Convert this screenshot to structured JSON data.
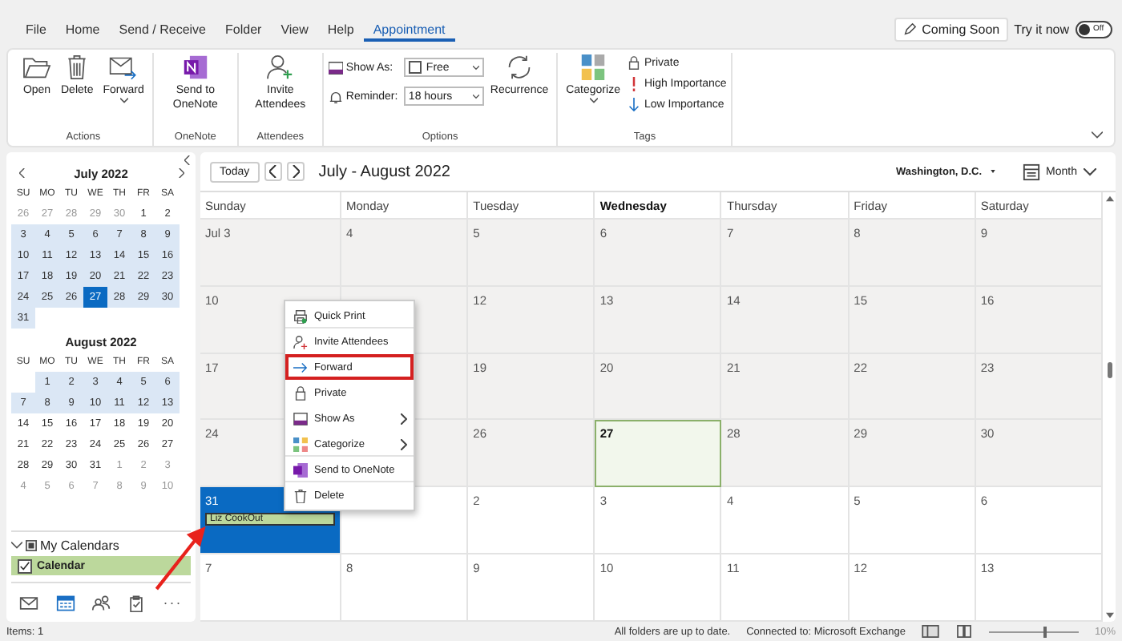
{
  "menu_tabs": [
    {
      "label": "File",
      "selected": false
    },
    {
      "label": "Home",
      "selected": false
    },
    {
      "label": "Send / Receive",
      "selected": false
    },
    {
      "label": "Folder",
      "selected": false
    },
    {
      "label": "View",
      "selected": false
    },
    {
      "label": "Help",
      "selected": false
    },
    {
      "label": "Appointment",
      "selected": true
    }
  ],
  "coming_soon": {
    "label": "Coming Soon",
    "try_label": "Try it now",
    "toggle_label": "Off",
    "on": false
  },
  "ribbon": {
    "groups": [
      {
        "label": "Actions",
        "kind": "buttons",
        "buttons": [
          {
            "label": "Open",
            "kind": "folder",
            "dropdown": false
          },
          {
            "label": "Delete",
            "kind": "trash",
            "dropdown": false
          },
          {
            "label": "Forward",
            "kind": "forward",
            "dropdown": true
          }
        ]
      },
      {
        "label": "OneNote",
        "kind": "buttons",
        "buttons": [
          {
            "label": "Send to OneNote",
            "kind": "onenote",
            "dropdown": false
          }
        ]
      },
      {
        "label": "Attendees",
        "kind": "buttons",
        "buttons": [
          {
            "label": "Invite Attendees",
            "kind": "person-add",
            "dropdown": false
          }
        ]
      },
      {
        "label": "Options",
        "kind": "options",
        "show_as": {
          "label": "Show As:",
          "value": "Free"
        },
        "reminder": {
          "label": "Reminder:",
          "value": "18 hours"
        },
        "recurrence": "Recurrence"
      },
      {
        "label": "Tags",
        "kind": "tags",
        "categorize": "Categorize",
        "tags": [
          {
            "label": "Private",
            "kind": "lock"
          },
          {
            "label": "High Importance",
            "kind": "high"
          },
          {
            "label": "Low Importance",
            "kind": "low"
          }
        ]
      }
    ]
  },
  "mini_calendars": [
    {
      "title": "July 2022",
      "weekdays": [
        "SU",
        "MO",
        "TU",
        "WE",
        "TH",
        "FR",
        "SA"
      ],
      "weeks": [
        {
          "shaded": false,
          "days": [
            {
              "d": "26",
              "muted": true,
              "today": false
            },
            {
              "d": "27",
              "muted": true,
              "today": false
            },
            {
              "d": "28",
              "muted": true,
              "today": false
            },
            {
              "d": "29",
              "muted": true,
              "today": false
            },
            {
              "d": "30",
              "muted": true,
              "today": false
            },
            {
              "d": "1",
              "muted": false,
              "today": false
            },
            {
              "d": "2",
              "muted": false,
              "today": false
            }
          ]
        },
        {
          "shaded": true,
          "days": [
            {
              "d": "3",
              "muted": false,
              "today": false
            },
            {
              "d": "4",
              "muted": false,
              "today": false
            },
            {
              "d": "5",
              "muted": false,
              "today": false
            },
            {
              "d": "6",
              "muted": false,
              "today": false
            },
            {
              "d": "7",
              "muted": false,
              "today": false
            },
            {
              "d": "8",
              "muted": false,
              "today": false
            },
            {
              "d": "9",
              "muted": false,
              "today": false
            }
          ]
        },
        {
          "shaded": true,
          "days": [
            {
              "d": "10",
              "muted": false,
              "today": false
            },
            {
              "d": "11",
              "muted": false,
              "today": false
            },
            {
              "d": "12",
              "muted": false,
              "today": false
            },
            {
              "d": "13",
              "muted": false,
              "today": false
            },
            {
              "d": "14",
              "muted": false,
              "today": false
            },
            {
              "d": "15",
              "muted": false,
              "today": false
            },
            {
              "d": "16",
              "muted": false,
              "today": false
            }
          ]
        },
        {
          "shaded": true,
          "days": [
            {
              "d": "17",
              "muted": false,
              "today": false
            },
            {
              "d": "18",
              "muted": false,
              "today": false
            },
            {
              "d": "19",
              "muted": false,
              "today": false
            },
            {
              "d": "20",
              "muted": false,
              "today": false
            },
            {
              "d": "21",
              "muted": false,
              "today": false
            },
            {
              "d": "22",
              "muted": false,
              "today": false
            },
            {
              "d": "23",
              "muted": false,
              "today": false
            }
          ]
        },
        {
          "shaded": true,
          "days": [
            {
              "d": "24",
              "muted": false,
              "today": false
            },
            {
              "d": "25",
              "muted": false,
              "today": false
            },
            {
              "d": "26",
              "muted": false,
              "today": false
            },
            {
              "d": "27",
              "muted": false,
              "today": true
            },
            {
              "d": "28",
              "muted": false,
              "today": false
            },
            {
              "d": "29",
              "muted": false,
              "today": false
            },
            {
              "d": "30",
              "muted": false,
              "today": false
            }
          ]
        },
        {
          "shaded": true,
          "days": [
            {
              "d": "31",
              "muted": false,
              "today": false
            }
          ]
        }
      ]
    },
    {
      "title": "August 2022",
      "weekdays": [
        "SU",
        "MO",
        "TU",
        "WE",
        "TH",
        "FR",
        "SA"
      ],
      "weeks": [
        {
          "shaded": true,
          "days": [
            {
              "d": "1",
              "muted": false,
              "today": false
            },
            {
              "d": "2",
              "muted": false,
              "today": false
            },
            {
              "d": "3",
              "muted": false,
              "today": false
            },
            {
              "d": "4",
              "muted": false,
              "today": false
            },
            {
              "d": "5",
              "muted": false,
              "today": false
            },
            {
              "d": "6",
              "muted": false,
              "today": false
            }
          ]
        },
        {
          "shaded": true,
          "days": [
            {
              "d": "7",
              "muted": false,
              "today": false
            },
            {
              "d": "8",
              "muted": false,
              "today": false
            },
            {
              "d": "9",
              "muted": false,
              "today": false
            },
            {
              "d": "10",
              "muted": false,
              "today": false
            },
            {
              "d": "11",
              "muted": false,
              "today": false
            },
            {
              "d": "12",
              "muted": false,
              "today": false
            },
            {
              "d": "13",
              "muted": false,
              "today": false
            }
          ]
        },
        {
          "shaded": false,
          "days": [
            {
              "d": "14",
              "muted": false,
              "today": false
            },
            {
              "d": "15",
              "muted": false,
              "today": false
            },
            {
              "d": "16",
              "muted": false,
              "today": false
            },
            {
              "d": "17",
              "muted": false,
              "today": false
            },
            {
              "d": "18",
              "muted": false,
              "today": false
            },
            {
              "d": "19",
              "muted": false,
              "today": false
            },
            {
              "d": "20",
              "muted": false,
              "today": false
            }
          ]
        },
        {
          "shaded": false,
          "days": [
            {
              "d": "21",
              "muted": false,
              "today": false
            },
            {
              "d": "22",
              "muted": false,
              "today": false
            },
            {
              "d": "23",
              "muted": false,
              "today": false
            },
            {
              "d": "24",
              "muted": false,
              "today": false
            },
            {
              "d": "25",
              "muted": false,
              "today": false
            },
            {
              "d": "26",
              "muted": false,
              "today": false
            },
            {
              "d": "27",
              "muted": false,
              "today": false
            }
          ]
        },
        {
          "shaded": false,
          "days": [
            {
              "d": "28",
              "muted": false,
              "today": false
            },
            {
              "d": "29",
              "muted": false,
              "today": false
            },
            {
              "d": "30",
              "muted": false,
              "today": false
            },
            {
              "d": "31",
              "muted": false,
              "today": false
            },
            {
              "d": "1",
              "muted": true,
              "today": false
            },
            {
              "d": "2",
              "muted": true,
              "today": false
            },
            {
              "d": "3",
              "muted": true,
              "today": false
            }
          ]
        },
        {
          "shaded": false,
          "days": [
            {
              "d": "4",
              "muted": true,
              "today": false
            },
            {
              "d": "5",
              "muted": true,
              "today": false
            },
            {
              "d": "6",
              "muted": true,
              "today": false
            },
            {
              "d": "7",
              "muted": true,
              "today": false
            },
            {
              "d": "8",
              "muted": true,
              "today": false
            },
            {
              "d": "9",
              "muted": true,
              "today": false
            },
            {
              "d": "10",
              "muted": true,
              "today": false
            }
          ]
        }
      ]
    }
  ],
  "folders": {
    "group": "My Calendars",
    "items": [
      {
        "label": "Calendar",
        "checked": true,
        "color": "#bcd89c"
      }
    ]
  },
  "nav": [
    {
      "kind": "mail",
      "selected": false
    },
    {
      "kind": "calendar",
      "selected": true
    },
    {
      "kind": "people",
      "selected": false
    },
    {
      "kind": "tasks",
      "selected": false
    },
    {
      "kind": "more",
      "label": "···",
      "selected": false
    }
  ],
  "calendar": {
    "today_button": "Today",
    "title": "July - August 2022",
    "location": "Washington, D.C.",
    "view": "Month",
    "columns": [
      {
        "label": "Sunday",
        "today": false
      },
      {
        "label": "Monday",
        "today": false
      },
      {
        "label": "Tuesday",
        "today": false
      },
      {
        "label": "Wednesday",
        "today": true
      },
      {
        "label": "Thursday",
        "today": false
      },
      {
        "label": "Friday",
        "today": false
      },
      {
        "label": "Saturday",
        "today": false
      }
    ],
    "weeks": [
      {
        "past": true,
        "days": [
          {
            "label": "Jul 3",
            "today": false,
            "selected": false
          },
          {
            "label": "4",
            "today": false,
            "selected": false
          },
          {
            "label": "5",
            "today": false,
            "selected": false
          },
          {
            "label": "6",
            "today": false,
            "selected": false
          },
          {
            "label": "7",
            "today": false,
            "selected": false
          },
          {
            "label": "8",
            "today": false,
            "selected": false
          },
          {
            "label": "9",
            "today": false,
            "selected": false
          }
        ]
      },
      {
        "past": true,
        "days": [
          {
            "label": "10",
            "today": false,
            "selected": false
          },
          {
            "today": false,
            "selected": false
          },
          {
            "label": "12",
            "today": false,
            "selected": false
          },
          {
            "label": "13",
            "today": false,
            "selected": false
          },
          {
            "label": "14",
            "today": false,
            "selected": false
          },
          {
            "label": "15",
            "today": false,
            "selected": false
          },
          {
            "label": "16",
            "today": false,
            "selected": false
          }
        ]
      },
      {
        "past": true,
        "days": [
          {
            "label": "17",
            "today": false,
            "selected": false
          },
          {
            "today": false,
            "selected": false
          },
          {
            "label": "19",
            "today": false,
            "selected": false
          },
          {
            "label": "20",
            "today": false,
            "selected": false
          },
          {
            "label": "21",
            "today": false,
            "selected": false
          },
          {
            "label": "22",
            "today": false,
            "selected": false
          },
          {
            "label": "23",
            "today": false,
            "selected": false
          }
        ]
      },
      {
        "past": true,
        "days": [
          {
            "label": "24",
            "today": false,
            "selected": false
          },
          {
            "today": false,
            "selected": false
          },
          {
            "label": "26",
            "today": false,
            "selected": false
          },
          {
            "label": "27",
            "today": true,
            "selected": false
          },
          {
            "label": "28",
            "today": false,
            "selected": false
          },
          {
            "label": "29",
            "today": false,
            "selected": false
          },
          {
            "label": "30",
            "today": false,
            "selected": false
          }
        ]
      },
      {
        "past": false,
        "days": [
          {
            "label": "31",
            "today": false,
            "selected": true,
            "events": [
              "Liz CookOut"
            ]
          },
          {
            "today": false,
            "selected": false
          },
          {
            "label": "2",
            "today": false,
            "selected": false
          },
          {
            "label": "3",
            "today": false,
            "selected": false
          },
          {
            "label": "4",
            "today": false,
            "selected": false
          },
          {
            "label": "5",
            "today": false,
            "selected": false
          },
          {
            "label": "6",
            "today": false,
            "selected": false
          }
        ]
      },
      {
        "past": false,
        "days": [
          {
            "label": "7",
            "today": false,
            "selected": false
          },
          {
            "label": "8",
            "today": false,
            "selected": false
          },
          {
            "label": "9",
            "today": false,
            "selected": false
          },
          {
            "label": "10",
            "today": false,
            "selected": false
          },
          {
            "label": "11",
            "today": false,
            "selected": false
          },
          {
            "label": "12",
            "today": false,
            "selected": false
          },
          {
            "label": "13",
            "today": false,
            "selected": false
          }
        ]
      }
    ]
  },
  "context_menu": [
    {
      "label": "Quick Print",
      "kind": "print",
      "submenu": false,
      "highlighted": false,
      "separator_after": true
    },
    {
      "label": "Invite Attendees",
      "kind": "person-add",
      "submenu": false,
      "highlighted": false,
      "separator_after": false
    },
    {
      "label": "Forward",
      "kind": "arrow",
      "submenu": false,
      "highlighted": true,
      "separator_after": false
    },
    {
      "label": "Private",
      "kind": "lock",
      "submenu": false,
      "highlighted": false,
      "separator_after": false
    },
    {
      "label": "Show As",
      "kind": "showas",
      "submenu": true,
      "highlighted": false,
      "separator_after": false
    },
    {
      "label": "Categorize",
      "kind": "categorize",
      "submenu": true,
      "highlighted": false,
      "separator_after": true
    },
    {
      "label": "Send to OneNote",
      "kind": "onenote",
      "submenu": false,
      "highlighted": false,
      "separator_after": true
    },
    {
      "label": "Delete",
      "kind": "trash",
      "submenu": false,
      "highlighted": false,
      "separator_after": false
    }
  ],
  "status_bar": {
    "items": "Items: 1",
    "sync": "All folders are up to date.",
    "connection": "Connected to: Microsoft Exchange",
    "zoom_slider": {
      "level": 0.6
    },
    "zoom": "10%"
  }
}
